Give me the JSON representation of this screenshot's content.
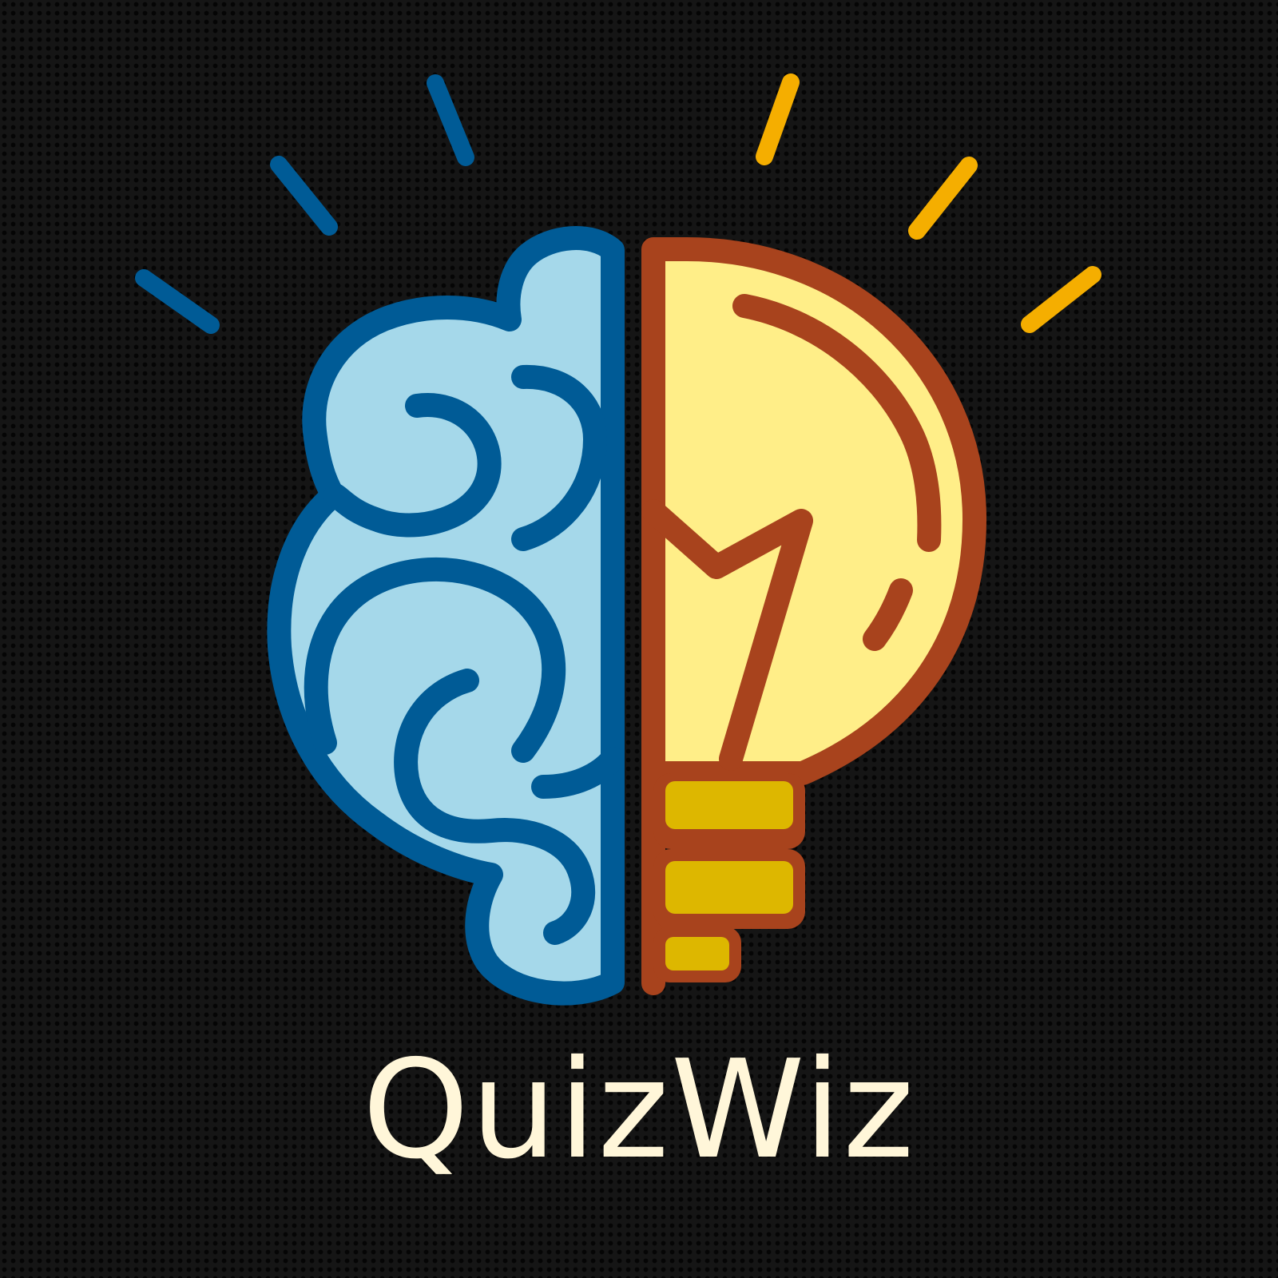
{
  "brand": {
    "name": "QuizWiz"
  },
  "colors": {
    "background": "#151515",
    "brain_fill": "#A5D8EA",
    "brain_stroke": "#005B96",
    "bulb_fill": "#FFEE88",
    "bulb_stroke": "#A8431D",
    "bulb_base": "#DDB700",
    "rays_left": "#005B96",
    "rays_right": "#F5AE00",
    "text": "#FFF6D9"
  },
  "icons": {
    "logo": "brain-lightbulb-icon"
  }
}
